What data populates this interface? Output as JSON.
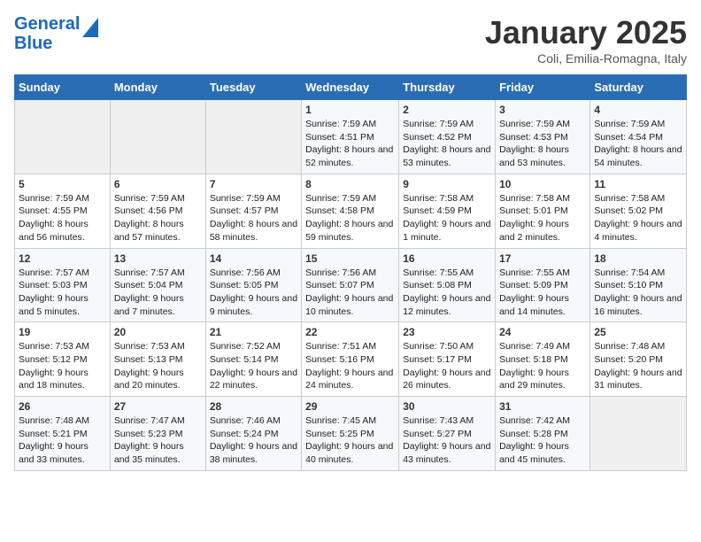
{
  "logo": {
    "line1": "General",
    "line2": "Blue"
  },
  "title": "January 2025",
  "subtitle": "Coli, Emilia-Romagna, Italy",
  "days_of_week": [
    "Sunday",
    "Monday",
    "Tuesday",
    "Wednesday",
    "Thursday",
    "Friday",
    "Saturday"
  ],
  "weeks": [
    [
      {
        "day": "",
        "info": ""
      },
      {
        "day": "",
        "info": ""
      },
      {
        "day": "",
        "info": ""
      },
      {
        "day": "1",
        "info": "Sunrise: 7:59 AM\nSunset: 4:51 PM\nDaylight: 8 hours and 52 minutes."
      },
      {
        "day": "2",
        "info": "Sunrise: 7:59 AM\nSunset: 4:52 PM\nDaylight: 8 hours and 53 minutes."
      },
      {
        "day": "3",
        "info": "Sunrise: 7:59 AM\nSunset: 4:53 PM\nDaylight: 8 hours and 53 minutes."
      },
      {
        "day": "4",
        "info": "Sunrise: 7:59 AM\nSunset: 4:54 PM\nDaylight: 8 hours and 54 minutes."
      }
    ],
    [
      {
        "day": "5",
        "info": "Sunrise: 7:59 AM\nSunset: 4:55 PM\nDaylight: 8 hours and 56 minutes."
      },
      {
        "day": "6",
        "info": "Sunrise: 7:59 AM\nSunset: 4:56 PM\nDaylight: 8 hours and 57 minutes."
      },
      {
        "day": "7",
        "info": "Sunrise: 7:59 AM\nSunset: 4:57 PM\nDaylight: 8 hours and 58 minutes."
      },
      {
        "day": "8",
        "info": "Sunrise: 7:59 AM\nSunset: 4:58 PM\nDaylight: 8 hours and 59 minutes."
      },
      {
        "day": "9",
        "info": "Sunrise: 7:58 AM\nSunset: 4:59 PM\nDaylight: 9 hours and 1 minute."
      },
      {
        "day": "10",
        "info": "Sunrise: 7:58 AM\nSunset: 5:01 PM\nDaylight: 9 hours and 2 minutes."
      },
      {
        "day": "11",
        "info": "Sunrise: 7:58 AM\nSunset: 5:02 PM\nDaylight: 9 hours and 4 minutes."
      }
    ],
    [
      {
        "day": "12",
        "info": "Sunrise: 7:57 AM\nSunset: 5:03 PM\nDaylight: 9 hours and 5 minutes."
      },
      {
        "day": "13",
        "info": "Sunrise: 7:57 AM\nSunset: 5:04 PM\nDaylight: 9 hours and 7 minutes."
      },
      {
        "day": "14",
        "info": "Sunrise: 7:56 AM\nSunset: 5:05 PM\nDaylight: 9 hours and 9 minutes."
      },
      {
        "day": "15",
        "info": "Sunrise: 7:56 AM\nSunset: 5:07 PM\nDaylight: 9 hours and 10 minutes."
      },
      {
        "day": "16",
        "info": "Sunrise: 7:55 AM\nSunset: 5:08 PM\nDaylight: 9 hours and 12 minutes."
      },
      {
        "day": "17",
        "info": "Sunrise: 7:55 AM\nSunset: 5:09 PM\nDaylight: 9 hours and 14 minutes."
      },
      {
        "day": "18",
        "info": "Sunrise: 7:54 AM\nSunset: 5:10 PM\nDaylight: 9 hours and 16 minutes."
      }
    ],
    [
      {
        "day": "19",
        "info": "Sunrise: 7:53 AM\nSunset: 5:12 PM\nDaylight: 9 hours and 18 minutes."
      },
      {
        "day": "20",
        "info": "Sunrise: 7:53 AM\nSunset: 5:13 PM\nDaylight: 9 hours and 20 minutes."
      },
      {
        "day": "21",
        "info": "Sunrise: 7:52 AM\nSunset: 5:14 PM\nDaylight: 9 hours and 22 minutes."
      },
      {
        "day": "22",
        "info": "Sunrise: 7:51 AM\nSunset: 5:16 PM\nDaylight: 9 hours and 24 minutes."
      },
      {
        "day": "23",
        "info": "Sunrise: 7:50 AM\nSunset: 5:17 PM\nDaylight: 9 hours and 26 minutes."
      },
      {
        "day": "24",
        "info": "Sunrise: 7:49 AM\nSunset: 5:18 PM\nDaylight: 9 hours and 29 minutes."
      },
      {
        "day": "25",
        "info": "Sunrise: 7:48 AM\nSunset: 5:20 PM\nDaylight: 9 hours and 31 minutes."
      }
    ],
    [
      {
        "day": "26",
        "info": "Sunrise: 7:48 AM\nSunset: 5:21 PM\nDaylight: 9 hours and 33 minutes."
      },
      {
        "day": "27",
        "info": "Sunrise: 7:47 AM\nSunset: 5:23 PM\nDaylight: 9 hours and 35 minutes."
      },
      {
        "day": "28",
        "info": "Sunrise: 7:46 AM\nSunset: 5:24 PM\nDaylight: 9 hours and 38 minutes."
      },
      {
        "day": "29",
        "info": "Sunrise: 7:45 AM\nSunset: 5:25 PM\nDaylight: 9 hours and 40 minutes."
      },
      {
        "day": "30",
        "info": "Sunrise: 7:43 AM\nSunset: 5:27 PM\nDaylight: 9 hours and 43 minutes."
      },
      {
        "day": "31",
        "info": "Sunrise: 7:42 AM\nSunset: 5:28 PM\nDaylight: 9 hours and 45 minutes."
      },
      {
        "day": "",
        "info": ""
      }
    ]
  ]
}
